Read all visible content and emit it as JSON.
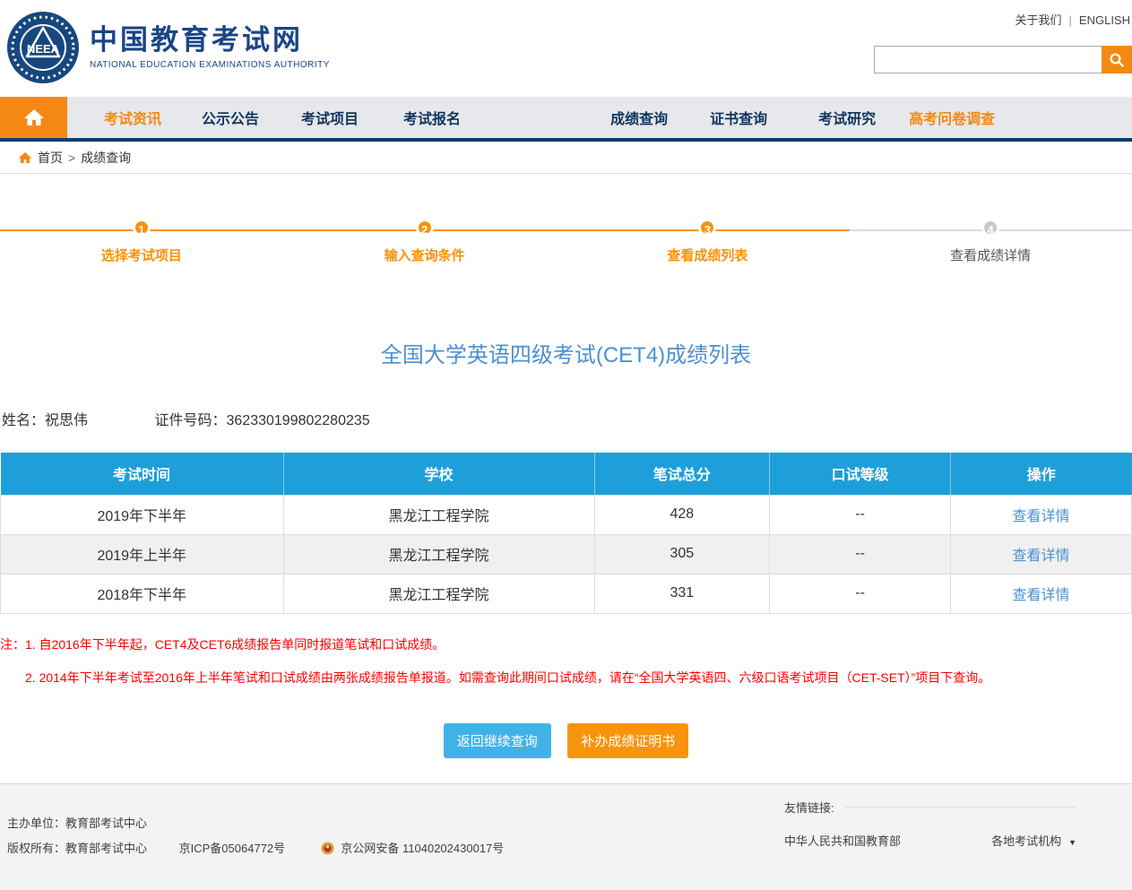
{
  "header": {
    "site_title": "中国教育考试网",
    "site_subtitle": "NATIONAL EDUCATION EXAMINATIONS AUTHORITY",
    "logo_text": "NEEA",
    "about_link": "关于我们",
    "link_separator": "|",
    "english_link": "ENGLISH",
    "search": {
      "value": "",
      "placeholder": ""
    }
  },
  "nav": {
    "items": [
      {
        "label": "考试资讯"
      },
      {
        "label": "公示公告"
      },
      {
        "label": "考试项目"
      },
      {
        "label": "考试报名"
      },
      {
        "label": "成绩查询"
      },
      {
        "label": "证书查询"
      },
      {
        "label": "考试研究"
      },
      {
        "label": "高考问卷调查"
      }
    ]
  },
  "breadcrumb": {
    "home": "首页",
    "separator": ">",
    "current": "成绩查询"
  },
  "steps": [
    {
      "number": "1",
      "label": "选择考试项目",
      "state": "active"
    },
    {
      "number": "2",
      "label": "输入查询条件",
      "state": "active"
    },
    {
      "number": "3",
      "label": "查看成绩列表",
      "state": "active"
    },
    {
      "number": "4",
      "label": "查看成绩详情",
      "state": "pending"
    }
  ],
  "main": {
    "title": "全国大学英语四级考试(CET4)成绩列表",
    "name_label": "姓名：",
    "name_value": "祝思伟",
    "id_label": "证件号码：",
    "id_value": "362330199802280235",
    "table": {
      "headers": [
        "考试时间",
        "学校",
        "笔试总分",
        "口试等级",
        "操作"
      ],
      "rows": [
        {
          "time": "2019年下半年",
          "school": "黑龙江工程学院",
          "written_score": "428",
          "oral_grade": "--",
          "action": "查看详情"
        },
        {
          "time": "2019年上半年",
          "school": "黑龙江工程学院",
          "written_score": "305",
          "oral_grade": "--",
          "action": "查看详情"
        },
        {
          "time": "2018年下半年",
          "school": "黑龙江工程学院",
          "written_score": "331",
          "oral_grade": "--",
          "action": "查看详情"
        }
      ]
    },
    "notes": [
      "注：1. 自2016年下半年起，CET4及CET6成绩报告单同时报道笔试和口试成绩。",
      "2. 2014年下半年考试至2016年上半年笔试和口试成绩由两张成绩报告单报道。如需查询此期间口试成绩，请在“全国大学英语四、六级口语考试项目（CET-SET）”项目下查询。"
    ],
    "buttons": {
      "back": "返回继续查询",
      "certificate": "补办成绩证明书"
    }
  },
  "footer": {
    "organizer_line": "主办单位：教育部考试中心",
    "copyright_line": "版权所有：教育部考试中心",
    "icp": "京ICP备05064772号",
    "police": "京公网安备 11040202430017号",
    "links_label": "友情链接:",
    "link_moe": "中华人民共和国教育部",
    "link_local": "各地考试机构",
    "dropdown_arrow": "▼"
  },
  "colors": {
    "brand_navy": "#1b4586",
    "nav_border_navy": "#0d3c72",
    "accent_orange": "#f58813",
    "step_orange": "#f8920a",
    "table_header_blue": "#1f9fd9",
    "title_blue": "#4a90d2",
    "note_red": "#ff0000",
    "button_blue": "#41b2e8",
    "button_orange": "#f8940c",
    "footer_bg": "#f3f3f3"
  }
}
